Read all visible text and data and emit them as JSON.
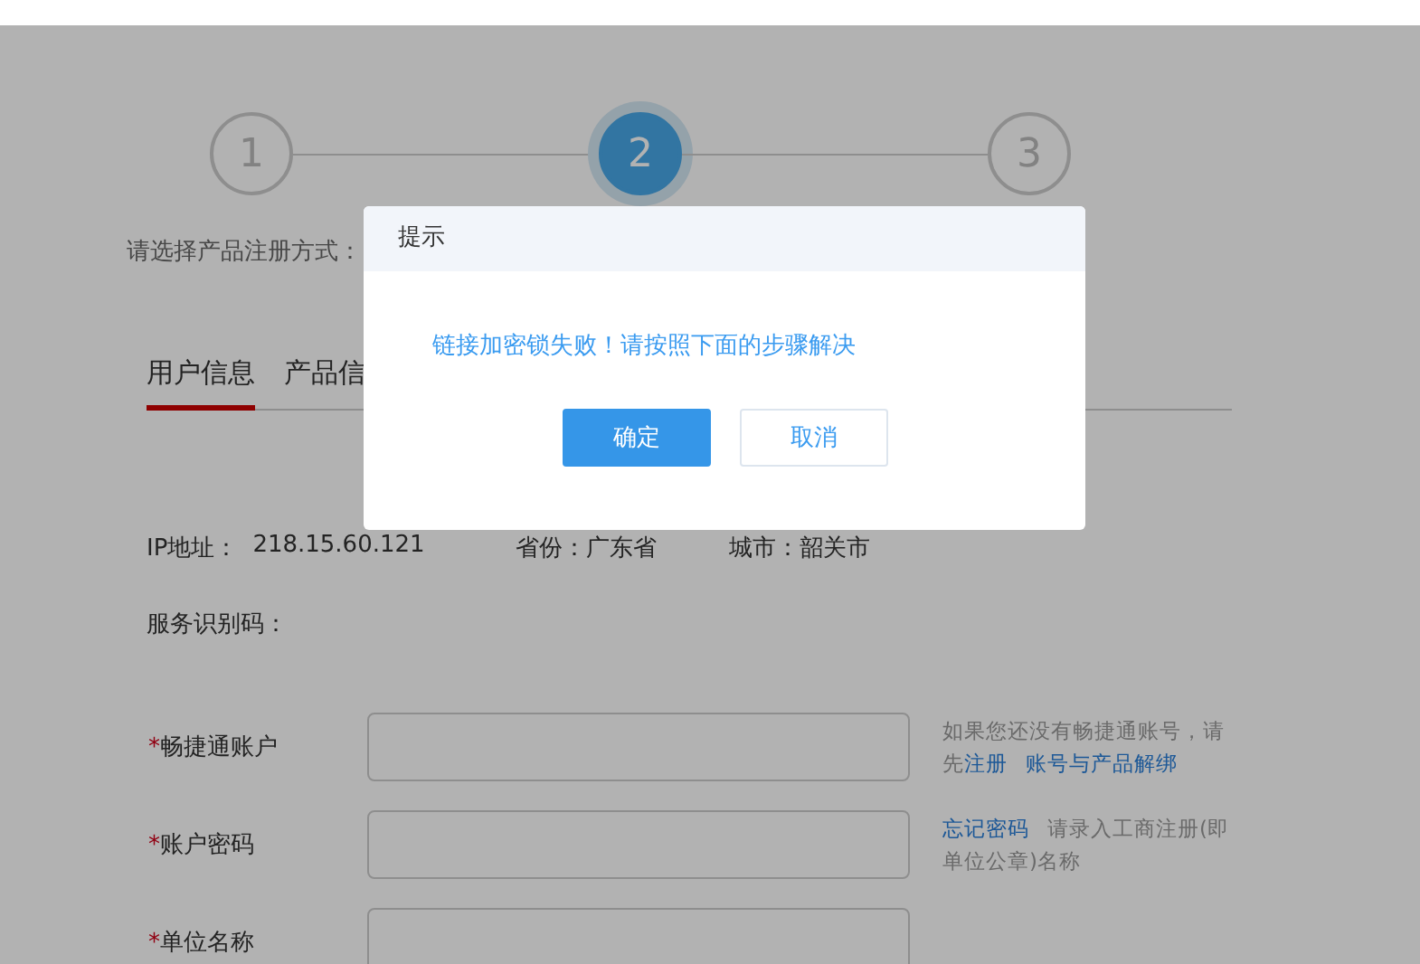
{
  "steps": [
    {
      "number": "1",
      "selected": false
    },
    {
      "number": "2",
      "selected": true
    },
    {
      "number": "3",
      "selected": false
    }
  ],
  "prompt": "请选择产品注册方式：",
  "tabs": [
    {
      "label": "用户信息",
      "selected": true
    },
    {
      "label": "产品信",
      "selected": false
    }
  ],
  "location": {
    "ip_label": "IP地址：",
    "ip": "218.15.60.121",
    "province": "省份：广东省",
    "city": "城市：韶关市"
  },
  "service_code_label": "服务识别码：",
  "form": [
    {
      "label": "畅捷通账户",
      "required_mark": "*",
      "help": [
        {
          "kind": "text",
          "text": "如果您还没有畅捷通账号，请先"
        },
        {
          "kind": "link",
          "text": "注册"
        },
        {
          "kind": "link",
          "text": "账号与产品解绑"
        }
      ]
    },
    {
      "label": "账户密码",
      "required_mark": "*",
      "help": [
        {
          "kind": "link",
          "text": "忘记密码"
        },
        {
          "kind": "text",
          "text": "请录入工商注册(即单位公章)名称"
        }
      ]
    },
    {
      "label": "单位名称",
      "required_mark": "*"
    }
  ],
  "dialog": {
    "title": "提示",
    "message": "链接加密锁失败！请按照下面的步骤解决",
    "buttons": [
      {
        "label": "确定",
        "kind": "primary"
      },
      {
        "label": "取消",
        "kind": "secondary"
      }
    ]
  }
}
